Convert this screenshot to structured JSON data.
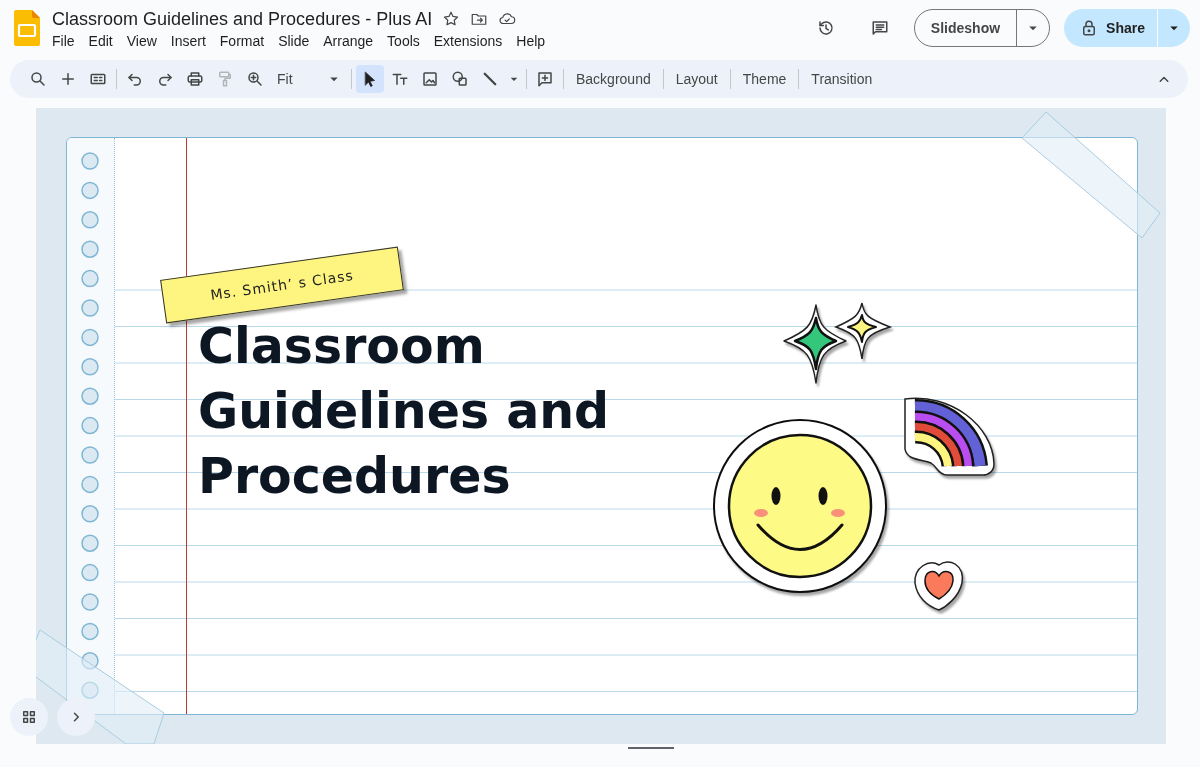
{
  "document": {
    "title": "Classroom Guidelines and Procedures - Plus AI"
  },
  "menu": [
    "File",
    "Edit",
    "View",
    "Insert",
    "Format",
    "Slide",
    "Arrange",
    "Tools",
    "Extensions",
    "Help"
  ],
  "actions": {
    "slideshow": "Slideshow",
    "share": "Share"
  },
  "toolbar": {
    "groups": [
      [
        {
          "kind": "search",
          "selected": false,
          "disabled": false
        },
        {
          "kind": "add",
          "selected": false,
          "disabled": false
        },
        {
          "kind": "layout",
          "selected": false,
          "disabled": false
        }
      ],
      [
        {
          "kind": "undo",
          "selected": false,
          "disabled": false
        },
        {
          "kind": "redo",
          "selected": false,
          "disabled": false
        },
        {
          "kind": "print",
          "selected": false,
          "disabled": false
        },
        {
          "kind": "paint",
          "selected": false,
          "disabled": true
        },
        {
          "kind": "zoom",
          "selected": false,
          "disabled": false
        },
        {
          "kind": "zoom-select",
          "label": "Fit",
          "selected": false,
          "disabled": false
        }
      ],
      [
        {
          "kind": "select",
          "selected": true,
          "disabled": false
        },
        {
          "kind": "textbox",
          "selected": false,
          "disabled": false
        },
        {
          "kind": "image",
          "selected": false,
          "disabled": false
        },
        {
          "kind": "shape",
          "selected": false,
          "disabled": false
        },
        {
          "kind": "line",
          "selected": false,
          "disabled": false
        },
        {
          "kind": "caret",
          "selected": false,
          "disabled": false
        }
      ],
      [
        {
          "kind": "comment",
          "selected": false,
          "disabled": false
        }
      ],
      [
        {
          "kind": "text",
          "label": "Background",
          "selected": false,
          "disabled": false
        }
      ],
      [
        {
          "kind": "text",
          "label": "Layout",
          "selected": false,
          "disabled": false
        }
      ],
      [
        {
          "kind": "text",
          "label": "Theme",
          "selected": false,
          "disabled": false
        }
      ],
      [
        {
          "kind": "text",
          "label": "Transition",
          "selected": false,
          "disabled": false
        }
      ]
    ]
  },
  "slide": {
    "label": "Ms. Smith’ s Class",
    "title": "Classroom Guidelines and Procedures"
  }
}
